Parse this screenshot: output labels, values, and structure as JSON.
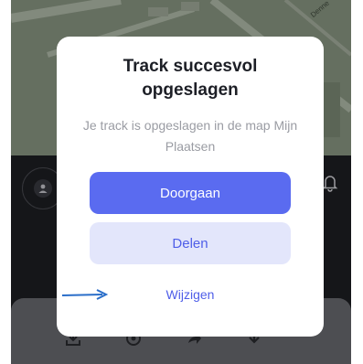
{
  "map": {
    "street_label": "Denne"
  },
  "modal": {
    "title": "Track succesvol opgeslagen",
    "message": "Je track is opgeslagen in de map Mijn Plaatsen",
    "primary_label": "Doorgaan",
    "secondary_label": "Delen",
    "link_label": "Wijzigen"
  },
  "colors": {
    "primary": "#5a6bf0",
    "secondary_bg": "#e3e6fb",
    "annotation_arrow": "#2a6ec9"
  }
}
